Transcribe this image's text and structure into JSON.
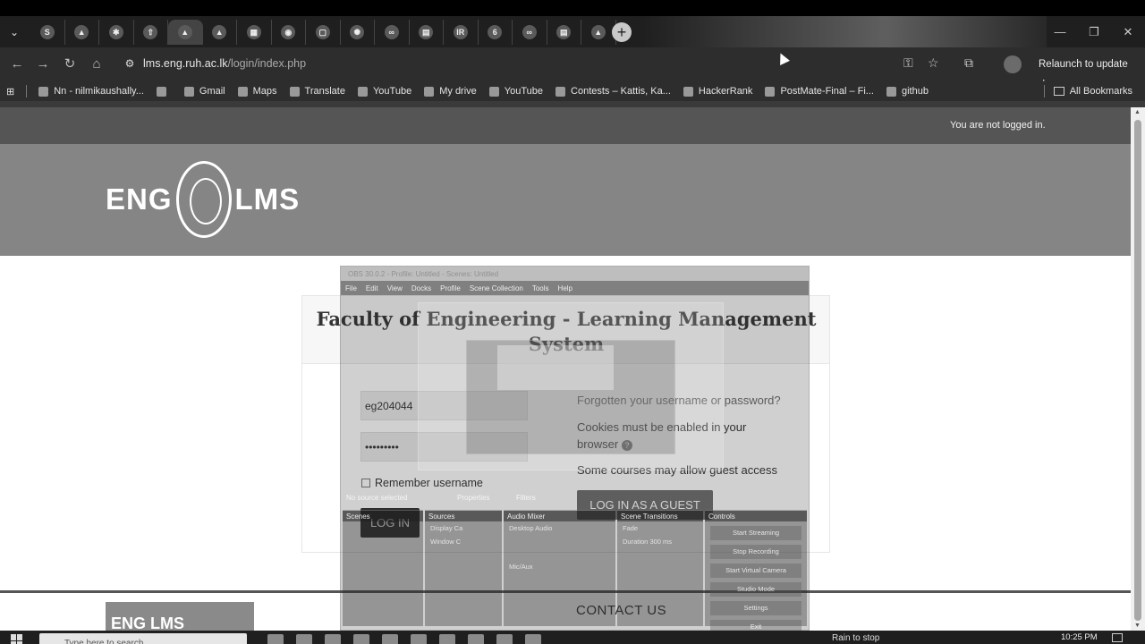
{
  "browser": {
    "tabs": [
      {
        "icon": "S"
      },
      {
        "icon": "drive"
      },
      {
        "icon": "gear"
      },
      {
        "icon": "arrow"
      },
      {
        "icon": "drive",
        "active": true
      },
      {
        "icon": "drive"
      },
      {
        "icon": "grid"
      },
      {
        "icon": "github"
      },
      {
        "icon": "box"
      },
      {
        "icon": "ai"
      },
      {
        "icon": "infinity"
      },
      {
        "icon": "doc"
      },
      {
        "icon": "IR"
      },
      {
        "icon": "6"
      },
      {
        "icon": "infinity"
      },
      {
        "icon": "doc"
      },
      {
        "icon": "drive"
      }
    ],
    "window_controls": {
      "minimize": "—",
      "restore": "❐",
      "close": "✕"
    },
    "url_host": "lms.eng.ruh.ac.lk",
    "url_path": "/login/index.php",
    "relaunch_label": "Relaunch to update",
    "bookmarks": [
      {
        "label": "Nn - nilmikaushally..."
      },
      {
        "label": ""
      },
      {
        "label": "Gmail"
      },
      {
        "label": "Maps"
      },
      {
        "label": "Translate"
      },
      {
        "label": "YouTube"
      },
      {
        "label": "My drive"
      },
      {
        "label": "YouTube"
      },
      {
        "label": "Contests – Kattis, Ka..."
      },
      {
        "label": "HackerRank"
      },
      {
        "label": "PostMate-Final – Fi..."
      },
      {
        "label": "github"
      }
    ],
    "all_bookmarks_label": "All Bookmarks"
  },
  "site": {
    "login_status": "You are not logged in.",
    "logo_left": "ENG",
    "logo_right": "LMS",
    "title": "Faculty of Engineering - Learning Management System",
    "username_value": "eg204044",
    "password_value": "•••••••••",
    "remember_label": "Remember username",
    "login_button": "LOG IN",
    "forgot_link": "Forgotten your username or password?",
    "cookies_note": "Cookies must be enabled in your browser",
    "guest_note": "Some courses may allow guest access",
    "guest_button": "LOG IN AS A GUEST",
    "footer_logo": "ENG LMS",
    "contact_heading": "CONTACT US"
  },
  "obs_overlay": {
    "title": "OBS 30.0.2 - Profile: Untitled - Scenes: Untitled",
    "menu": [
      "File",
      "Edit",
      "View",
      "Docks",
      "Profile",
      "Scene Collection",
      "Tools",
      "Help"
    ],
    "no_source": "No source selected",
    "properties": "Properties",
    "filters": "Filters",
    "panels": {
      "scenes": "Scenes",
      "sources": "Sources",
      "audio_mixer": "Audio Mixer",
      "scene_transitions": "Scene Transitions",
      "controls": "Controls"
    },
    "sources": [
      "Display Ca",
      "Window C"
    ],
    "audio": [
      "Desktop Audio",
      "Mic/Aux"
    ],
    "transition": "Fade",
    "duration_label": "Duration",
    "duration_value": "300 ms",
    "control_buttons": [
      "Start Streaming",
      "Stop Recording",
      "Start Virtual Camera",
      "Studio Mode",
      "Settings",
      "Exit"
    ]
  },
  "taskbar": {
    "search_placeholder": "Type here to search",
    "weather": "Rain to stop",
    "clock": "10:25 PM"
  }
}
